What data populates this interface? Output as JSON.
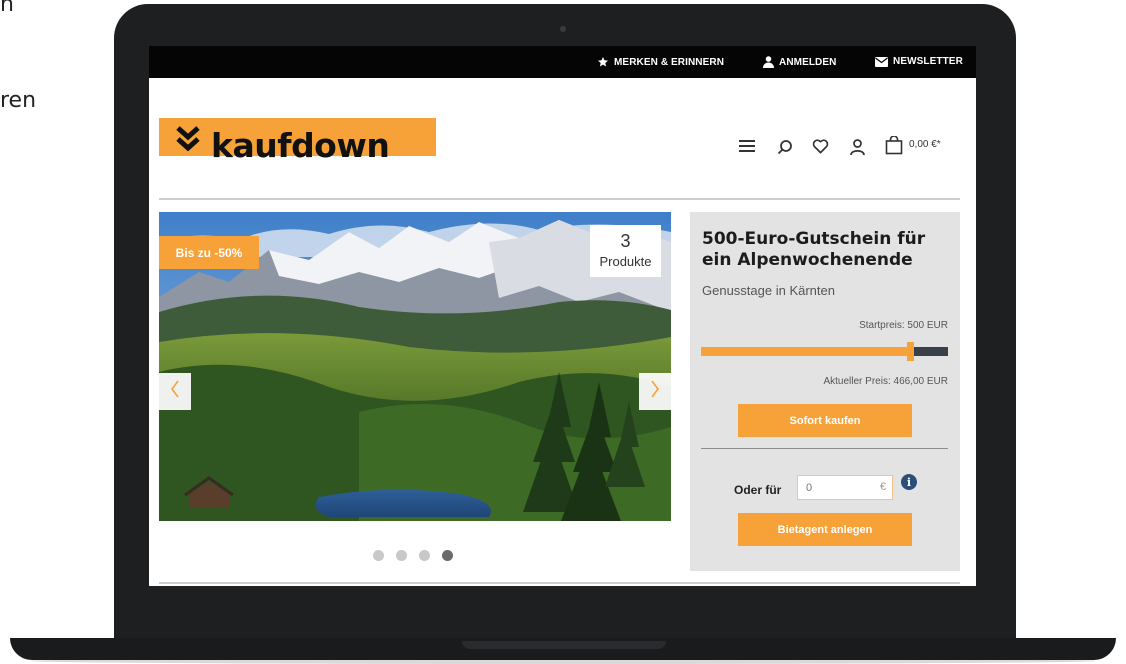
{
  "side_text": {
    "line_a": "n",
    "line_b": "ren"
  },
  "topbar": {
    "items": [
      {
        "label": "MERKEN & ERINNERN",
        "icon": "star-icon"
      },
      {
        "label": "ANMELDEN",
        "icon": "user-icon"
      },
      {
        "label": "NEWSLETTER",
        "icon": "envelope-icon"
      }
    ]
  },
  "header": {
    "logo_text": "kaufdown",
    "cart_amount": "0,00 €*",
    "icons": [
      "menu-icon",
      "search-icon",
      "heart-icon",
      "account-icon",
      "cart-icon"
    ]
  },
  "slider": {
    "sale_badge": "Bis zu -50%",
    "product_count": "3",
    "product_label": "Produkte",
    "dots_total": 4,
    "active_dot": 4
  },
  "offer": {
    "title": "500-Euro-Gutschein für ein Alpenwochenende",
    "subtitle": "Genusstage in Kärnten",
    "start_price": "Startpreis: 500 EUR",
    "current_price": "Aktueller Preis: 466,00 EUR",
    "price_progress": 0.85,
    "buy_button": "Sofort kaufen",
    "bid_label": "Oder für",
    "bid_placeholder": "0",
    "bid_currency": "€",
    "bid_button": "Bietagent anlegen"
  },
  "colors": {
    "accent": "#f7a239",
    "topbar": "#050505",
    "panel": "#e3e3e3",
    "progress_track": "#394049",
    "info": "#2c4f7a"
  }
}
